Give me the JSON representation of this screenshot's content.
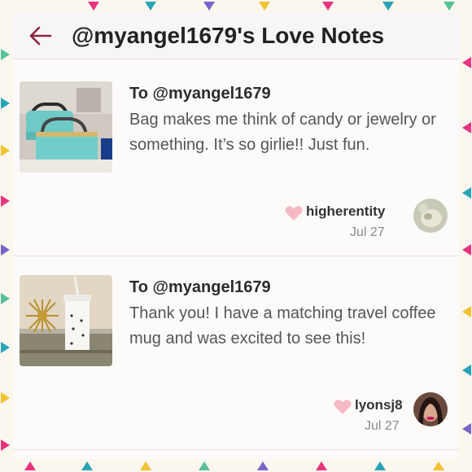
{
  "header": {
    "title": "@myangel1679's Love Notes",
    "back_icon": "back-arrow-icon",
    "accent_color": "#8b2742"
  },
  "notes": [
    {
      "to": "To @myangel1679",
      "message": "Bag makes me think of candy or jewelry or something. It’s so girlie!! Just fun.",
      "username": "higherentity",
      "date": "Jul 27",
      "heart_icon": "heart-icon"
    },
    {
      "to": "To @myangel1679",
      "message": "Thank you! I have a matching travel coffee mug and was excited to see this!",
      "username": "lyonsj8",
      "date": "Jul 27",
      "heart_icon": "heart-icon"
    }
  ],
  "colors": {
    "heart": "#f6b9c3",
    "frame_triangles": [
      "#e8337e",
      "#2aa3b8",
      "#f2c230",
      "#7a63c8",
      "#57c29a"
    ]
  }
}
